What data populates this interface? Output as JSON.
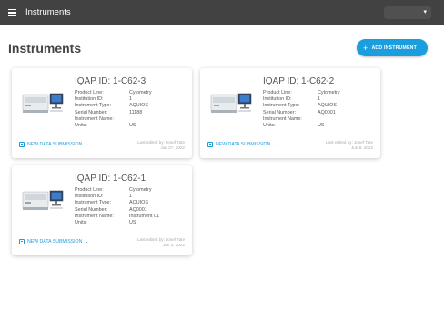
{
  "header": {
    "title": "Instruments",
    "account_value": ""
  },
  "page": {
    "title": "Instruments",
    "add_button_label": "ADD INSTRUMENT"
  },
  "colors": {
    "header_bg": "#424242",
    "accent": "#1a9ede",
    "card_bg": "#ffffff"
  },
  "field_labels": [
    "Product Line:",
    "Institution ID:",
    "Instrument Type:",
    "Serial Number:",
    "Instrument Name:",
    "Units:"
  ],
  "cards": [
    {
      "title": "IQAP ID: 1-C62-3",
      "values": [
        "Cytometry",
        "1",
        "AQUIOS",
        "11188",
        "",
        "US"
      ],
      "submission_label": "NEW DATA SUBMISSION",
      "edited_by": "Last edited by: Josef Tate",
      "edited_date": "Jun 27, 2022"
    },
    {
      "title": "IQAP ID: 1-C62-2",
      "values": [
        "Cytometry",
        "1",
        "AQUIOS",
        "AQ0001",
        "",
        "US"
      ],
      "submission_label": "NEW DATA SUBMISSION",
      "edited_by": "Last edited by: Josef Tate",
      "edited_date": "Jun 8, 2022"
    },
    {
      "title": "IQAP ID: 1-C62-1",
      "values": [
        "Cytometry",
        "1",
        "AQUIOS",
        "AQ0001",
        "Instrument 01",
        "US"
      ],
      "submission_label": "NEW DATA SUBMISSION",
      "edited_by": "Last edited by: Josef Tate",
      "edited_date": "Jun 3, 2022"
    }
  ]
}
